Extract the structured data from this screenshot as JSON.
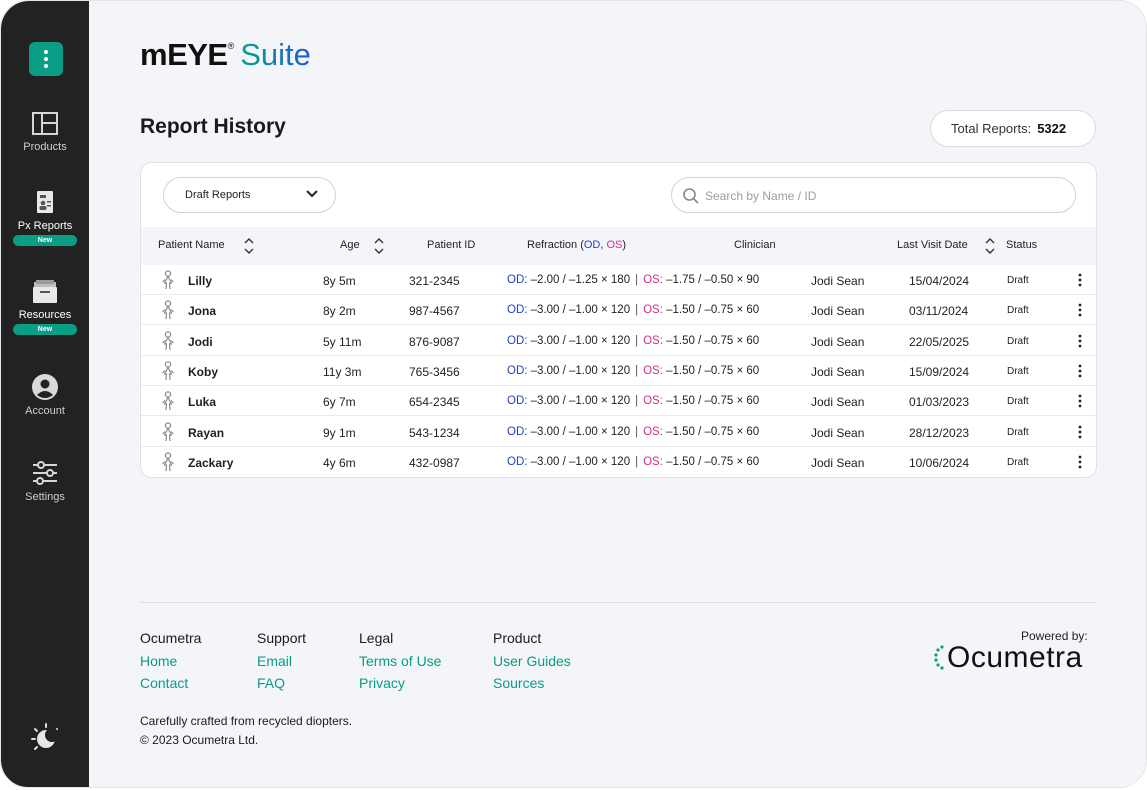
{
  "sidebar": {
    "items": [
      {
        "label": "Products",
        "icon": "layout-icon"
      },
      {
        "label": "Px Reports",
        "icon": "report-icon",
        "badge": "New"
      },
      {
        "label": "Resources",
        "icon": "folder-icon",
        "badge": "New"
      },
      {
        "label": "Account",
        "icon": "account-icon"
      },
      {
        "label": "Settings",
        "icon": "sliders-icon"
      }
    ]
  },
  "header": {
    "brand_main": "mEYE",
    "brand_reg": "®",
    "brand_suite": "Suite"
  },
  "page": {
    "title": "Report History",
    "total_label": "Total Reports:",
    "total_value": "5322"
  },
  "filters": {
    "report_type": "Draft Reports",
    "search_placeholder": "Search by Name / ID"
  },
  "table": {
    "headers": {
      "name": "Patient Name",
      "age": "Age",
      "pid": "Patient ID",
      "refraction_prefix": "Refraction (",
      "refraction_od": "OD",
      "refraction_comma": ", ",
      "refraction_os": "OS",
      "refraction_suffix": ")",
      "clinician": "Clinician",
      "last_visit": "Last Visit Date",
      "status": "Status"
    },
    "od_label": "OD:",
    "os_label": "OS:",
    "divider": "|",
    "rows": [
      {
        "name": "Lilly",
        "age": "8y 5m",
        "pid": "321-2345",
        "od": "–2.00 / –1.25 × 180",
        "os": "–1.75 / –0.50 × 90",
        "clinician": "Jodi Sean",
        "date": "15/04/2024",
        "status": "Draft"
      },
      {
        "name": "Jona",
        "age": "8y 2m",
        "pid": "987-4567",
        "od": "–3.00 / –1.00 × 120",
        "os": "–1.50 / –0.75 × 60",
        "clinician": "Jodi Sean",
        "date": "03/11/2024",
        "status": "Draft"
      },
      {
        "name": "Jodi",
        "age": "5y 11m",
        "pid": "876-9087",
        "od": "–3.00 / –1.00 × 120",
        "os": "–1.50 / –0.75 × 60",
        "clinician": "Jodi Sean",
        "date": "22/05/2025",
        "status": "Draft"
      },
      {
        "name": "Koby",
        "age": "11y 3m",
        "pid": "765-3456",
        "od": "–3.00 / –1.00 × 120",
        "os": "–1.50 / –0.75 × 60",
        "clinician": "Jodi Sean",
        "date": "15/09/2024",
        "status": "Draft"
      },
      {
        "name": "Luka",
        "age": "6y 7m",
        "pid": "654-2345",
        "od": "–3.00 / –1.00 × 120",
        "os": "–1.50 / –0.75 × 60",
        "clinician": "Jodi Sean",
        "date": "01/03/2023",
        "status": "Draft"
      },
      {
        "name": "Rayan",
        "age": "9y 1m",
        "pid": "543-1234",
        "od": "–3.00 / –1.00 × 120",
        "os": "–1.50 / –0.75 × 60",
        "clinician": "Jodi Sean",
        "date": "28/12/2023",
        "status": "Draft"
      },
      {
        "name": "Zackary",
        "age": "4y 6m",
        "pid": "432-0987",
        "od": "–3.00 / –1.00 × 120",
        "os": "–1.50 / –0.75 × 60",
        "clinician": "Jodi Sean",
        "date": "10/06/2024",
        "status": "Draft"
      }
    ]
  },
  "footer": {
    "columns": [
      {
        "heading": "Ocumetra",
        "links": [
          "Home",
          "Contact"
        ]
      },
      {
        "heading": "Support",
        "links": [
          "Email",
          "FAQ"
        ]
      },
      {
        "heading": "Legal",
        "links": [
          "Terms of Use",
          "Privacy"
        ]
      },
      {
        "heading": "Product",
        "links": [
          "User Guides",
          "Sources"
        ]
      }
    ],
    "powered_by": "Powered by:",
    "powered_brand": "Ocumetra",
    "tagline": "Carefully crafted from recycled diopters.",
    "copyright": "© 2023 Ocumetra Ltd."
  },
  "colors": {
    "accent": "#0b9e86",
    "od": "#1f3fc9",
    "os": "#d12f86",
    "sidebar": "#222222"
  }
}
